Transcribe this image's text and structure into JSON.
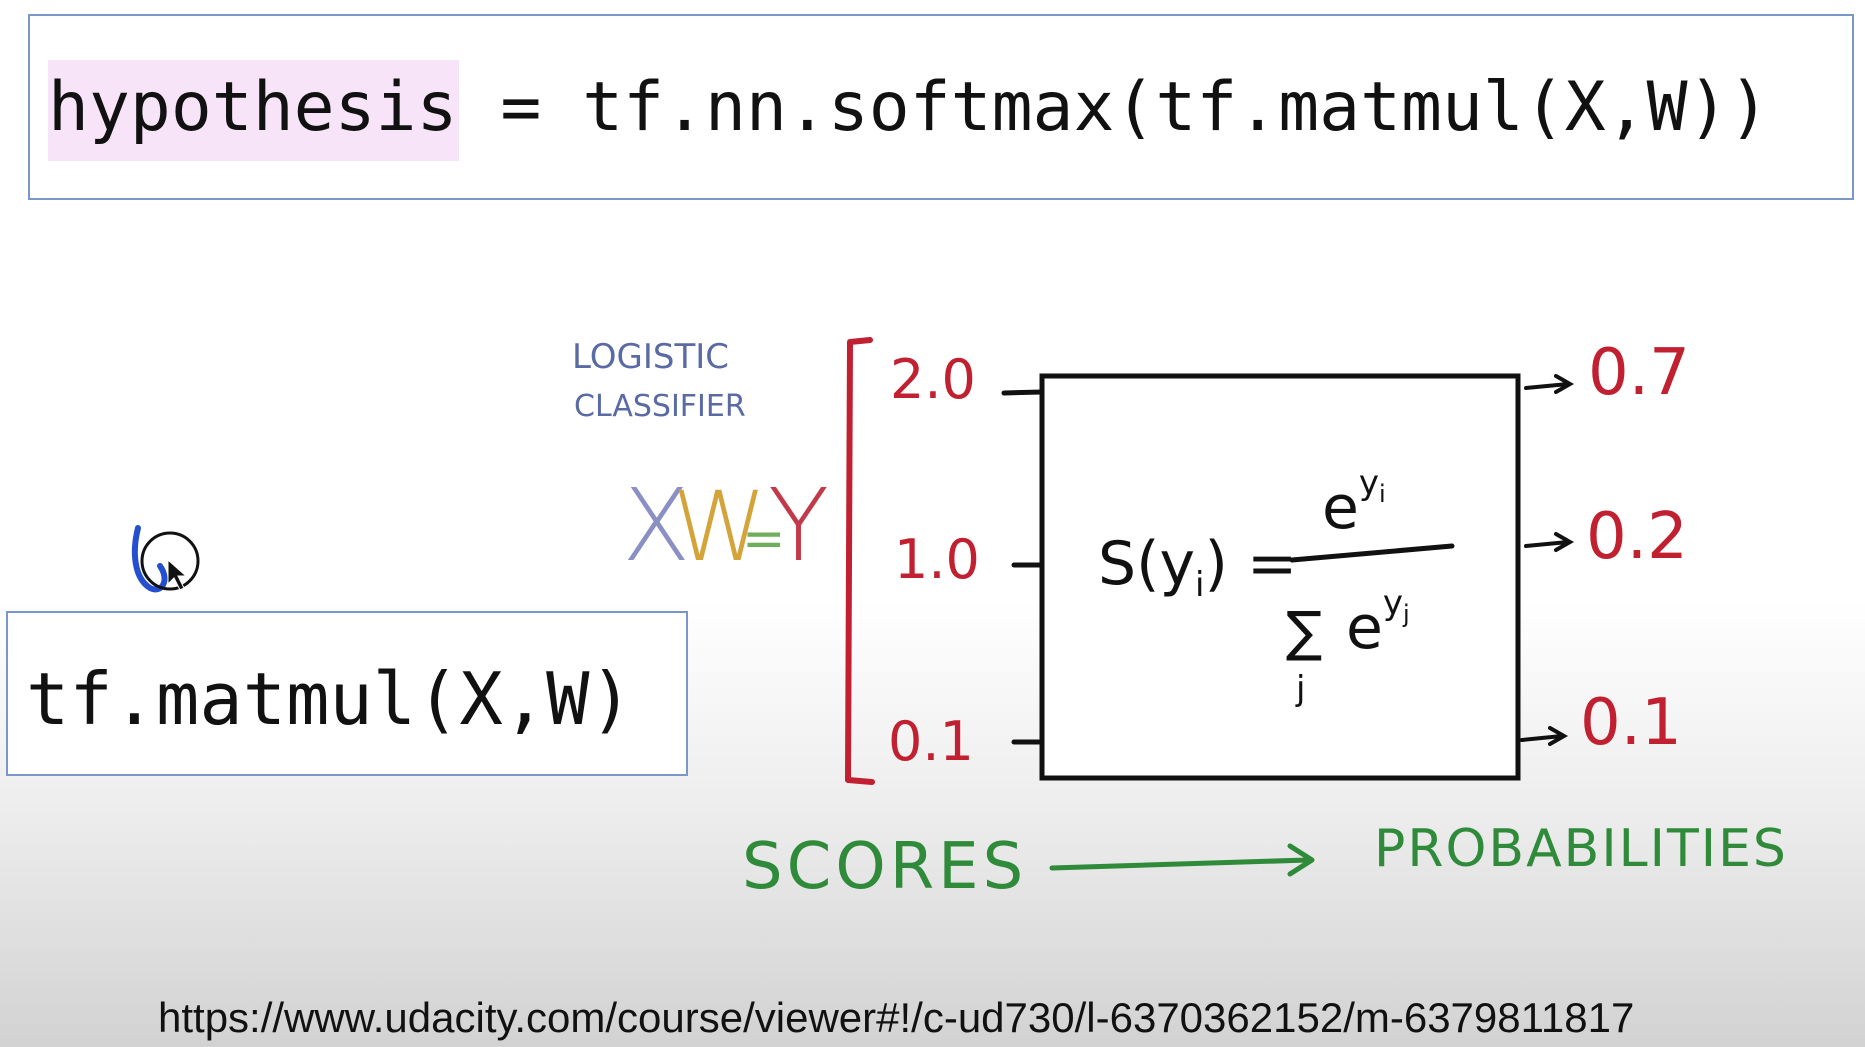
{
  "top_code": {
    "highlight": "hypothesis",
    "rest": " = tf.nn.softmax(tf.matmul(X,W))"
  },
  "bottom_code": "tf.matmul(X,W)",
  "diagram": {
    "caption_line1": "LOGISTIC",
    "caption_line2": "CLASSIFIER",
    "eq_x": "X",
    "eq_w": "W",
    "eq_eq": "=",
    "eq_y": "Y",
    "scores": [
      "2.0",
      "1.0",
      "0.1"
    ],
    "probabilities": [
      "0.7",
      "0.2",
      "0.1"
    ],
    "scores_label": "SCORES",
    "probabilities_label": "PROBABILITIES",
    "formula_lhs": "S(y",
    "formula_lhs_sub": "i",
    "formula_lhs_close": ") =",
    "numerator_base": "e",
    "numerator_exp": "y",
    "numerator_exp_sub": "i",
    "denominator_sum": "∑",
    "denominator_sum_index": "j",
    "denominator_base": "e",
    "denominator_exp": "y",
    "denominator_exp_sub": "j"
  },
  "url": "https://www.udacity.com/course/viewer#!/c-ud730/l-6370362152/m-6379811817",
  "colors": {
    "box_border": "#7b96c8",
    "highlight": "#f8e4f8",
    "caption": "#5a6aa5",
    "eq_x": "#8a8fc4",
    "eq_w": "#d4a43a",
    "eq_eq": "#6fae5a",
    "eq_y": "#c23a4a",
    "scores_red": "#c02030",
    "green": "#2f8a3a",
    "pen_blue": "#2450d0"
  }
}
